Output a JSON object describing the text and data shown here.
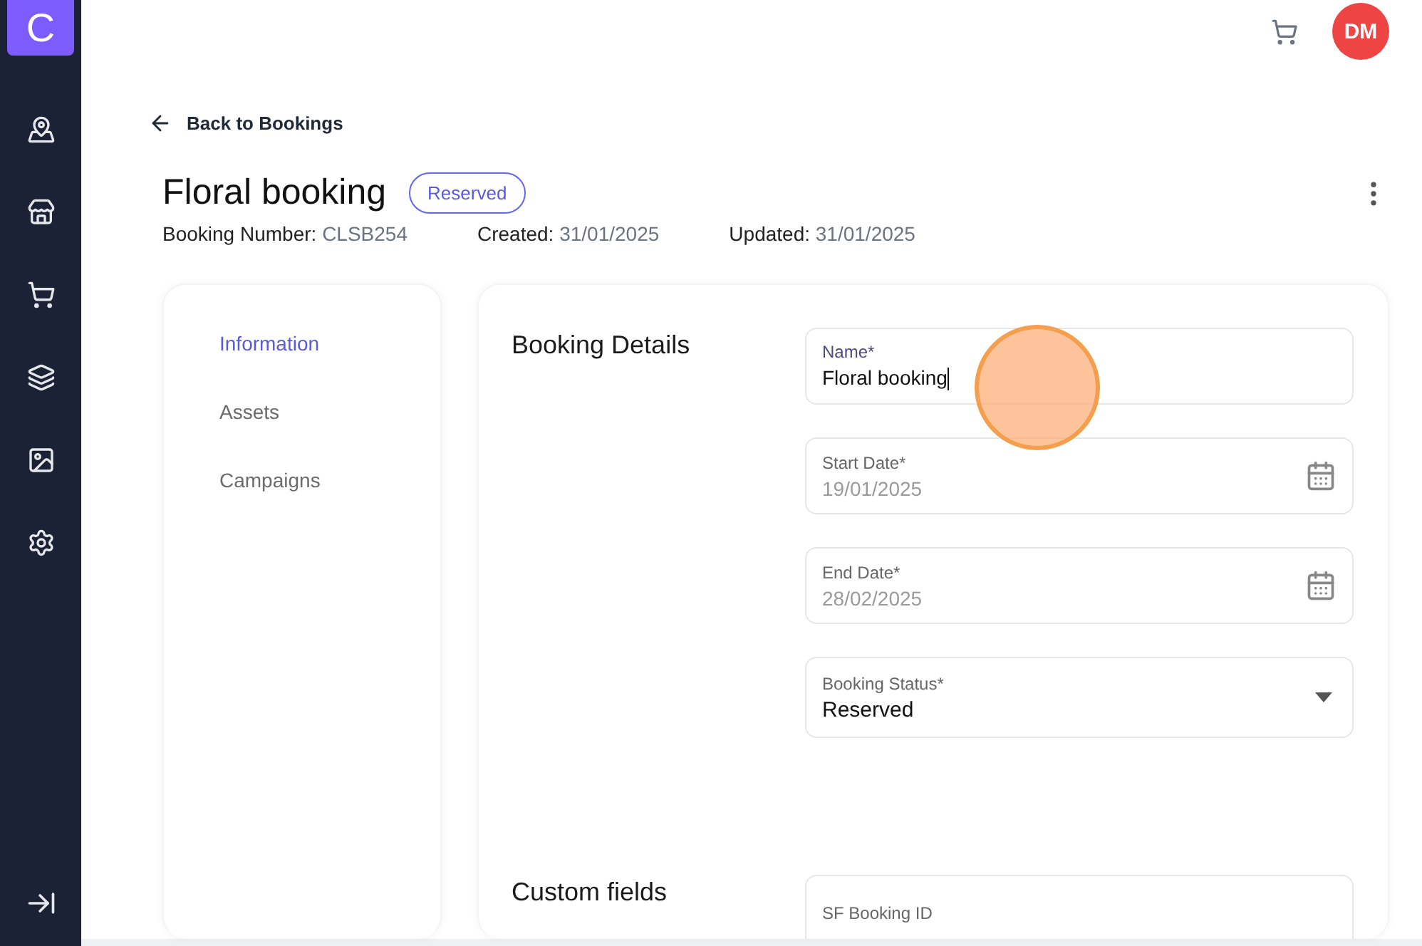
{
  "sidebar": {
    "logo": "C",
    "items": [
      {
        "selected": false
      },
      {
        "selected": false
      },
      {
        "selected": false
      },
      {
        "selected": false
      },
      {
        "selected": false
      },
      {
        "selected": false
      }
    ]
  },
  "header": {
    "avatar": "DM"
  },
  "back_link": "Back to Bookings",
  "title": "Floral booking",
  "status_badge": "Reserved",
  "meta": [
    {
      "label": "Booking Number:",
      "value": "CLSB254"
    },
    {
      "label": "Created:",
      "value": "31/01/2025"
    },
    {
      "label": "Updated:",
      "value": "31/01/2025"
    }
  ],
  "tabs": [
    {
      "label": "Information",
      "selected": true
    },
    {
      "label": "Assets",
      "selected": false
    },
    {
      "label": "Campaigns",
      "selected": false
    }
  ],
  "sections": [
    {
      "title": "Booking Details",
      "fields": [
        {
          "kind": "text",
          "label": "Name*",
          "value": "Floral booking",
          "focused": true,
          "disabled": false
        },
        {
          "kind": "date",
          "label": "Start Date*",
          "value": "19/01/2025",
          "focused": false,
          "disabled": true
        },
        {
          "kind": "date",
          "label": "End Date*",
          "value": "28/02/2025",
          "focused": false,
          "disabled": true
        },
        {
          "kind": "select",
          "label": "Booking Status*",
          "value": "Reserved",
          "focused": false,
          "disabled": false
        }
      ]
    },
    {
      "title": "Custom fields",
      "fields": [
        {
          "kind": "text",
          "label": "SF Booking ID",
          "focused": false
        }
      ]
    }
  ]
}
